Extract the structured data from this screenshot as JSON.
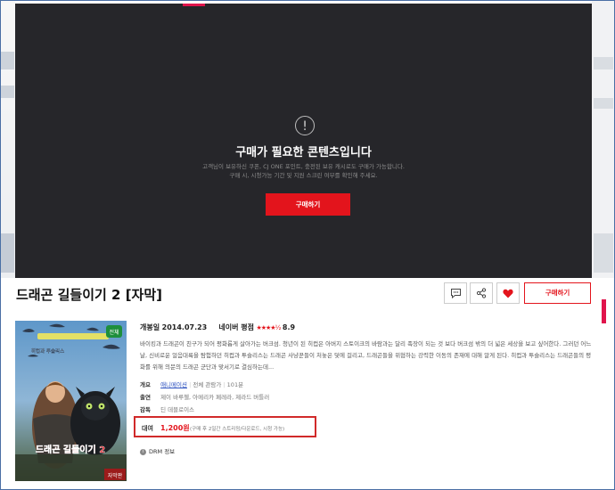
{
  "player": {
    "alert_glyph": "!",
    "notice_title": "구매가 필요한 콘텐츠입니다",
    "notice_line1": "고객님이 보유하신 쿠폰, CJ ONE 포인트, 충전된 보유 캐시로도 구매가 가능합니다.",
    "notice_line2": "구매 시, 시청가능 기간 및 지원 스크린 여부를 확인해 주세요.",
    "buy_button": "구매하기"
  },
  "header": {
    "title": "드래곤 길들이기 2 [자막]",
    "buy_button": "구매하기",
    "icons": [
      "comment-icon",
      "share-icon",
      "heart-icon"
    ]
  },
  "poster": {
    "rating_badge": "전체",
    "title_text": "드래곤 길들이기 2",
    "subtitle_badge": "자막판"
  },
  "meta": {
    "release_label": "개봉일",
    "release_date": "2014.07.23",
    "naver_label": "네이버 평점",
    "stars": "★★★★½",
    "score": "8.9"
  },
  "description": "바이킹과 드래곤이 친구가 되어 평화롭게 살아가는 버크섬. 청년이 된 히컵은 아버지 스토이크의 바람과는 달리 족장이 되는 것 보다 버크섬 밖의 더 넓은 세상을 보고 싶어한다. 그러던 어느 날, 신비로운 얼음대륙을 탐험하던 히컵과 투슬리스는 드래곤 사냥꾼들이 처놓은 덫에 걸리고, 드래곤들을 위협하는 강력한 이동의 존재에 대해 알게 된다. 히컵과 투슬리스는 드래곤들의 평화를 위해 의문의 드래곤 군단과 맞서기로 결심하는데...",
  "info": {
    "overview_label": "개요",
    "genre": "애니메이션",
    "audience": "전체 관람가",
    "runtime": "101분",
    "cast_label": "출연",
    "cast": "제이 바루첼, 아메리카 페레라, 제라드 버틀러",
    "director_label": "감독",
    "director": "딘 데블로이스"
  },
  "rent": {
    "label": "대여",
    "price": "1,200원",
    "note": "(구매 후 2일간 스트리밍/다운로드, 시청 가능)"
  },
  "drm": {
    "label": "DRM 정보"
  },
  "colors": {
    "accent": "#e3141c",
    "player_bg": "#26262a",
    "highlight_border": "#d12a2a"
  }
}
